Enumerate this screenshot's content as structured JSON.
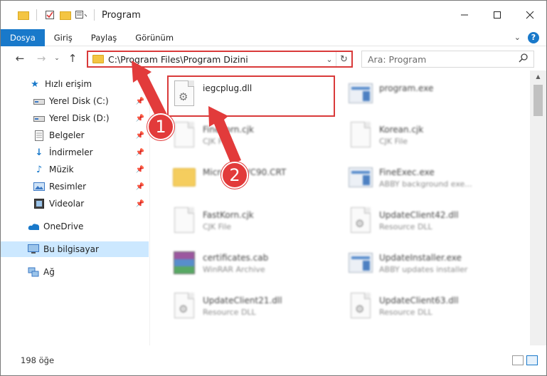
{
  "window": {
    "title": "Program"
  },
  "ribbon": {
    "tabs": [
      "Dosya",
      "Giriş",
      "Paylaş",
      "Görünüm"
    ]
  },
  "address": {
    "path": "C:\\Program Files\\Program Dizini"
  },
  "search": {
    "placeholder": "Ara: Program"
  },
  "sidebar": {
    "items": [
      {
        "label": "Hızlı erişim",
        "icon": "star-icon"
      },
      {
        "label": "Yerel Disk (C:)",
        "icon": "drive-icon",
        "pinned": true
      },
      {
        "label": "Yerel Disk (D:)",
        "icon": "drive-icon",
        "pinned": true
      },
      {
        "label": "Belgeler",
        "icon": "documents-icon",
        "pinned": true
      },
      {
        "label": "İndirmeler",
        "icon": "download-icon",
        "pinned": true
      },
      {
        "label": "Müzik",
        "icon": "music-icon",
        "pinned": true
      },
      {
        "label": "Resimler",
        "icon": "pictures-icon",
        "pinned": true
      },
      {
        "label": "Videolar",
        "icon": "videos-icon",
        "pinned": true
      },
      {
        "label": "OneDrive",
        "icon": "cloud-icon"
      },
      {
        "label": "Bu bilgisayar",
        "icon": "computer-icon",
        "selected": true
      },
      {
        "label": "Ağ",
        "icon": "network-icon"
      }
    ]
  },
  "files": [
    {
      "name": "iegcplug.dll",
      "type": "",
      "icon": "dll-icon",
      "highlight": true
    },
    {
      "name": "program.exe",
      "type": "",
      "icon": "exe-icon"
    },
    {
      "name": "FineKorn.cjk",
      "type": "CJK File",
      "icon": "file-icon"
    },
    {
      "name": "Korean.cjk",
      "type": "CJK File",
      "icon": "file-icon"
    },
    {
      "name": "Microsoft.VC90.CRT",
      "type": "",
      "icon": "folder-icon"
    },
    {
      "name": "FineExec.exe",
      "type": "ABBY background exe...",
      "icon": "exe-icon"
    },
    {
      "name": "FastKorn.cjk",
      "type": "CJK File",
      "icon": "file-icon"
    },
    {
      "name": "UpdateClient42.dll",
      "type": "Resource DLL",
      "icon": "dll-icon"
    },
    {
      "name": "certificates.cab",
      "type": "WinRAR Archive",
      "icon": "archive-icon"
    },
    {
      "name": "UpdateInstaller.exe",
      "type": "ABBY updates installer",
      "icon": "exe-icon"
    },
    {
      "name": "UpdateClient21.dll",
      "type": "Resource DLL",
      "icon": "dll-icon"
    },
    {
      "name": "UpdateClient63.dll",
      "type": "Resource DLL",
      "icon": "dll-icon"
    }
  ],
  "annotations": {
    "step1": "1",
    "step2": "2"
  },
  "status": {
    "item_count": "198 öğe"
  },
  "colors": {
    "accent": "#1979ca",
    "highlight": "#d93a3a",
    "selected_bg": "#cce8ff"
  }
}
